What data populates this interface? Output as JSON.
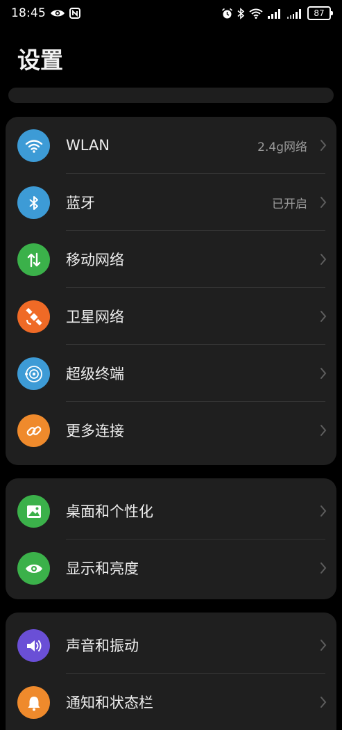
{
  "status_bar": {
    "time": "18:45",
    "battery": "87",
    "left_icons": [
      "eye-icon",
      "nfc-icon"
    ],
    "right_icons": [
      "alarm-icon",
      "bluetooth-icon",
      "wifi-icon",
      "signal-icon",
      "signal-icon"
    ]
  },
  "page": {
    "title": "设置"
  },
  "cards": [
    {
      "items": [
        {
          "label": "WLAN",
          "value": "2.4g网络",
          "icon": "wifi-icon",
          "color": "#3d9bd6"
        },
        {
          "label": "蓝牙",
          "value": "已开启",
          "icon": "bluetooth-icon",
          "color": "#3d9bd6"
        },
        {
          "label": "移动网络",
          "value": "",
          "icon": "mobile-data-icon",
          "color": "#3bb14a"
        },
        {
          "label": "卫星网络",
          "value": "",
          "icon": "satellite-icon",
          "color": "#ef6a26"
        },
        {
          "label": "超级终端",
          "value": "",
          "icon": "super-device-icon",
          "color": "#3d9bd6"
        },
        {
          "label": "更多连接",
          "value": "",
          "icon": "link-icon",
          "color": "#ef8a2c"
        }
      ]
    },
    {
      "items": [
        {
          "label": "桌面和个性化",
          "value": "",
          "icon": "image-icon",
          "color": "#3bb14a"
        },
        {
          "label": "显示和亮度",
          "value": "",
          "icon": "eye-icon",
          "color": "#3bb14a"
        }
      ]
    },
    {
      "items": [
        {
          "label": "声音和振动",
          "value": "",
          "icon": "volume-icon",
          "color": "#6a4fd6"
        },
        {
          "label": "通知和状态栏",
          "value": "",
          "icon": "bell-icon",
          "color": "#ef8a2c"
        }
      ]
    }
  ]
}
